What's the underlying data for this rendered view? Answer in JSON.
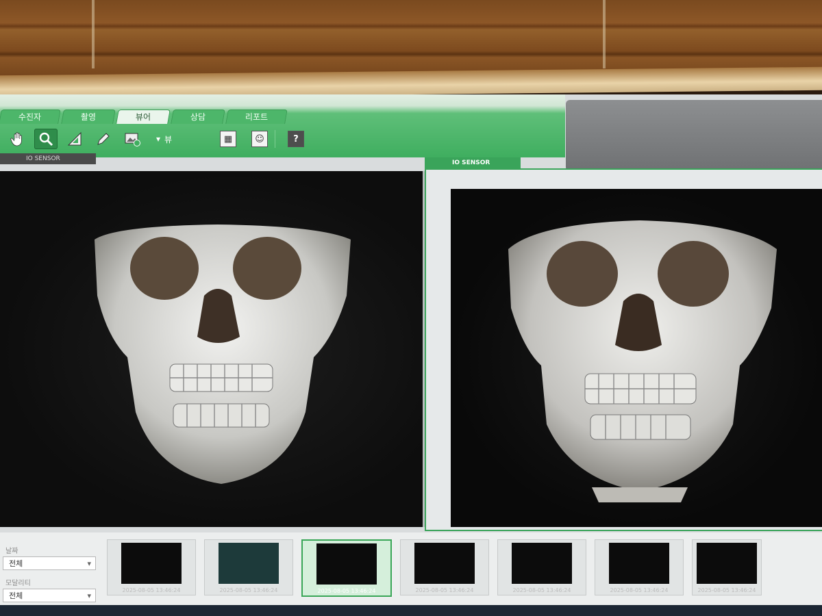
{
  "toolbar": {
    "tabs": [
      {
        "label": "수진자",
        "active": false
      },
      {
        "label": "촬영",
        "active": false
      },
      {
        "label": "뷰어",
        "active": true
      },
      {
        "label": "상담",
        "active": false
      },
      {
        "label": "리포트",
        "active": false
      }
    ],
    "view_label": "뷰",
    "help_label": "?"
  },
  "viewports": {
    "left_label": "IO SENSOR",
    "right_label": "IO SENSOR"
  },
  "filters": {
    "date_label": "날짜",
    "date_value": "전체",
    "modality_label": "모달리티",
    "modality_value": "전체"
  },
  "thumbnails": [
    {
      "timestamp": "2025-08-05 13:46:24",
      "kind": "skull-oblique",
      "selected": false
    },
    {
      "timestamp": "2025-08-05 13:46:24",
      "kind": "sagittal-slice",
      "selected": false
    },
    {
      "timestamp": "2025-08-05 13:46:24",
      "kind": "skull-frontal",
      "selected": true
    },
    {
      "timestamp": "2025-08-05 13:46:24",
      "kind": "skull-inferior",
      "selected": false
    },
    {
      "timestamp": "2025-08-05 13:46:24",
      "kind": "skull-lateral",
      "selected": false
    },
    {
      "timestamp": "2025-08-05 13:46:24",
      "kind": "skull-frontal",
      "selected": false
    },
    {
      "timestamp": "2025-08-05 13:46:24",
      "kind": "skull-inferior",
      "selected": false
    }
  ],
  "colors": {
    "accent_green": "#3fae5f",
    "selected_border": "#39a657"
  }
}
